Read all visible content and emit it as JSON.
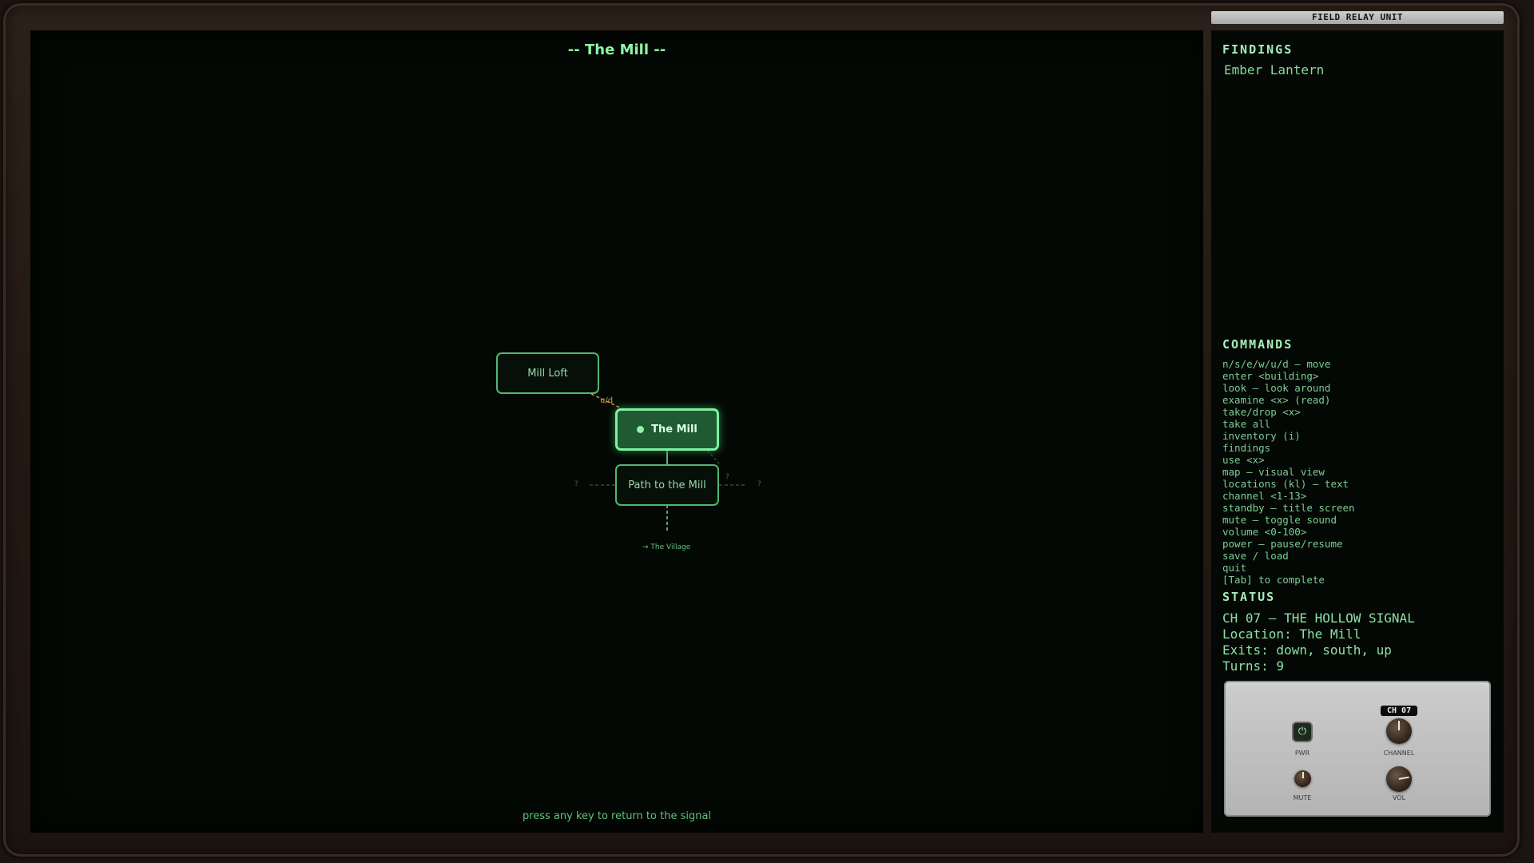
{
  "map": {
    "title": "-- The Mill --",
    "footer": "press any key to return to the signal",
    "rooms": {
      "loft": "Mill Loft",
      "current": "The Mill",
      "path": "Path to the Mill"
    },
    "exit_label_village": "→ The Village",
    "updown_label": "u/d",
    "unknown_mark": "?"
  },
  "sidebar": {
    "relay_label": "FIELD RELAY UNIT",
    "findings_header": "FINDINGS",
    "findings": [
      "Ember Lantern"
    ],
    "commands_header": "COMMANDS",
    "commands": [
      "n/s/e/w/u/d — move",
      "enter <building>",
      "look — look around",
      "examine <x> (read)",
      "take/drop <x>",
      "take all",
      "inventory (i)",
      "findings",
      "use <x>",
      "map — visual view",
      "locations (kl) — text",
      "channel <1-13>",
      "standby — title screen",
      "mute — toggle sound",
      "volume <0-100>",
      "power — pause/resume",
      "save / load",
      "quit",
      "[Tab] to complete"
    ],
    "status_header": "STATUS",
    "status": {
      "channel_line": "CH 07 — THE HOLLOW SIGNAL",
      "location_line": "Location: The Mill",
      "exits_line": "Exits: down, south, up",
      "turns_line": "Turns: 9"
    }
  },
  "panel": {
    "pwr_label": "PWR",
    "channel_label": "CHANNEL",
    "mute_label": "MUTE",
    "vol_label": "VOL",
    "channel_badge": "CH 07",
    "power_icon": "power-icon"
  }
}
